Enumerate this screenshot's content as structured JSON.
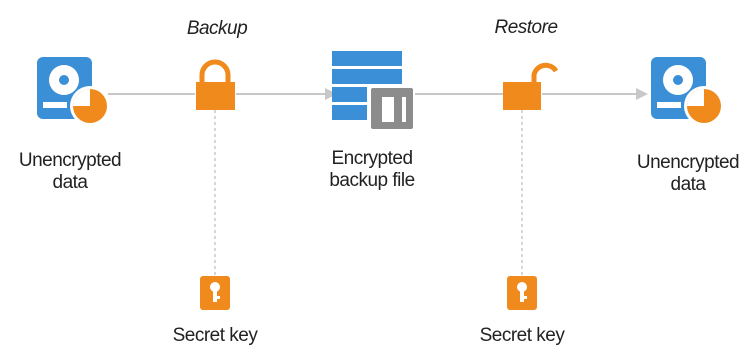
{
  "stages": {
    "backup": "Backup",
    "restore": "Restore"
  },
  "nodes": {
    "source": {
      "line1": "Unencrypted",
      "line2": "data"
    },
    "encrypted": {
      "line1": "Encrypted",
      "line2": "backup file"
    },
    "destination": {
      "line1": "Unencrypted",
      "line2": "data"
    }
  },
  "keys": {
    "backup_key": "Secret key",
    "restore_key": "Secret key"
  },
  "colors": {
    "disk_blue": "#3b8fd6",
    "accent_orange": "#f08a1c",
    "connector_gray": "#c8c8c8",
    "file_gray": "#8c8c8c"
  }
}
